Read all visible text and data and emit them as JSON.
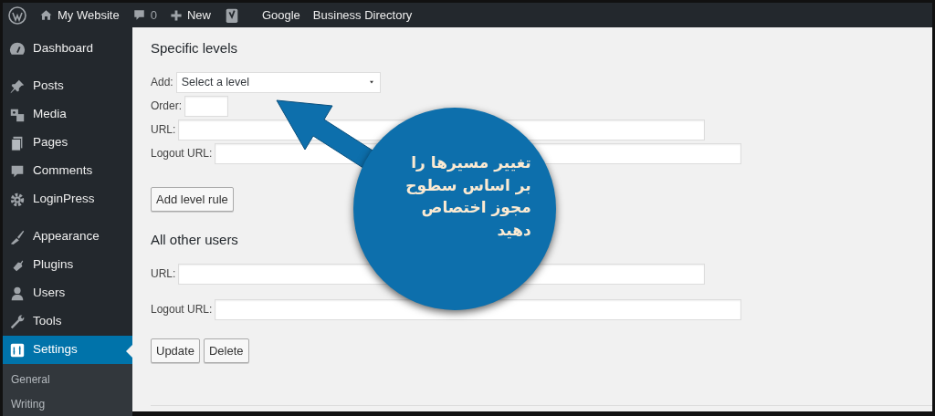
{
  "admin_bar": {
    "site_name": "My Website",
    "comments_count": "0",
    "new_label": "New",
    "links": [
      "Google",
      "Business Directory"
    ]
  },
  "sidebar": {
    "groups": [
      [
        {
          "label": "Dashboard",
          "selected": false
        }
      ],
      [
        {
          "label": "Posts",
          "selected": false
        },
        {
          "label": "Media",
          "selected": false
        },
        {
          "label": "Pages",
          "selected": false
        },
        {
          "label": "Comments",
          "selected": false
        },
        {
          "label": "LoginPress",
          "selected": false
        }
      ],
      [
        {
          "label": "Appearance",
          "selected": false
        },
        {
          "label": "Plugins",
          "selected": false
        },
        {
          "label": "Users",
          "selected": false
        },
        {
          "label": "Tools",
          "selected": false
        },
        {
          "label": "Settings",
          "selected": true
        }
      ]
    ],
    "submenu": [
      "General",
      "Writing"
    ]
  },
  "specific_levels": {
    "title": "Specific levels",
    "add_label": "Add:",
    "select_value": "Select a level",
    "order_label": "Order:",
    "url_label": "URL:",
    "logout_label": "Logout URL:",
    "button": "Add level rule"
  },
  "all_other_users": {
    "title": "All other users",
    "url_label": "URL:",
    "logout_label": "Logout URL:"
  },
  "buttons": [
    "Update",
    "Delete"
  ],
  "callout": {
    "lines": [
      "تغییر مسیرها را",
      "بر اساس سطوح",
      "مجوز اختصاص",
      "دهید"
    ]
  }
}
